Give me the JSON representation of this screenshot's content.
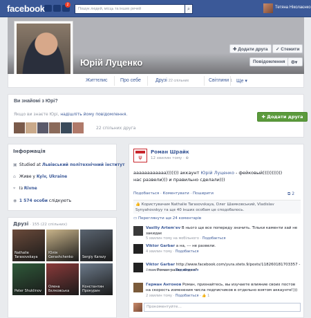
{
  "topbar": {
    "logo": "facebook",
    "search_placeholder": "Пошук людей, місць та інших речей",
    "notif_count": "2",
    "user_name": "Тетяна Ніколаєнко"
  },
  "profile": {
    "name": "Юрій Луценко",
    "add_friend": "Додати друга",
    "follow": "Стежити",
    "message": "Повідомлення",
    "settings_icon": "gear-icon"
  },
  "tabs": [
    {
      "label": "Життєпис",
      "count": ""
    },
    {
      "label": "Про себе",
      "count": ""
    },
    {
      "label": "Друзі",
      "count": "22 спільних"
    },
    {
      "label": "Світлини",
      "count": "1"
    },
    {
      "label": "Ще",
      "count": ""
    }
  ],
  "know": {
    "heading": "Ви знайомі з Юрі?",
    "sub_before": "Якщо ви знаєте Юрі, ",
    "sub_link": "надішліть йому повідомлення.",
    "mutual": "22 спільних друга",
    "add_friend": "Додати друга"
  },
  "info": {
    "heading": "Інформація",
    "studied_prefix": "Studied at ",
    "studied": "Львівський політехнічний інститут",
    "lives_prefix": "Живе у ",
    "lives": "Kyiv, Ukraine",
    "from_prefix": "Із ",
    "from": "Rivne",
    "followers_count": "1 574 особи",
    "followers_suffix": " слідкують"
  },
  "friends": {
    "heading": "Друзі",
    "count": " · 155 (22 спільних)",
    "items": [
      {
        "name": "Nathalie Tarasovskaya",
        "color": "#6a4a3a"
      },
      {
        "name": "Юлія Gerashchenko",
        "color": "#c9b48a"
      },
      {
        "name": "Sergiy Karazy",
        "color": "#5a6470"
      },
      {
        "name": "Peter Shuklinov",
        "color": "#2f5a3a"
      },
      {
        "name": "Олена Бєлковська",
        "color": "#8a3a3a"
      },
      {
        "name": "Константин Прокурин",
        "color": "#6c7a8a"
      }
    ]
  },
  "post": {
    "author": "Роман Шрайк",
    "time": "12 хвилин тому · ",
    "text_before": "аааааааааааа))))))) аккаунт ",
    "text_link": "Юрій Луценко",
    "text_after": " - фейковый)))))))))))",
    "text_line2": "нас развели))) и правильно сделали)))",
    "actions": "Подобається · Коментувати · Поширити",
    "shares": "2",
    "likes": "Користувачам Nathalie Tarasovskaya, Олег Шамковський, Vladislav Synyahovskyy та ще 40 інших особам це сподобалось.",
    "more_comments": "Переглянути ще 24 коментарів",
    "comments": [
      {
        "author": "Vasiliy Artem'ev",
        "text": "В нього ще все попереду значить. Тільки каменти хай не закидає",
        "meta": "5 хвилин тому на мобільного · ",
        "meta_link": "Подобається",
        "color": "#3a3a3a"
      },
      {
        "author": "Viktor Garbar",
        "text": "а на, --- не развели.",
        "meta": "4 хвилин тому · ",
        "meta_link": "Подобається",
        "color": "#222222"
      },
      {
        "author": "Viktor Garbar",
        "text": "http://www.facebook.com/yura.stets.9/posts/118260181703357 -- пан Роман разве видел?",
        "meta": "3 хвилин тому · ",
        "meta_link": "Подобається",
        "color": "#222222"
      },
      {
        "author": "Герман Антонов",
        "text": "Роман, признайтесь, вы изучаете влияние своих постов на скорость изменения числа подписчиков в отдельно взятом аккаунте!)))",
        "meta": "2 хвилин тому · ",
        "meta_link": "Подобається · ",
        "likes": "1",
        "color": "#7a5a3a"
      }
    ],
    "comment_placeholder": "Прокоментуйте…"
  }
}
